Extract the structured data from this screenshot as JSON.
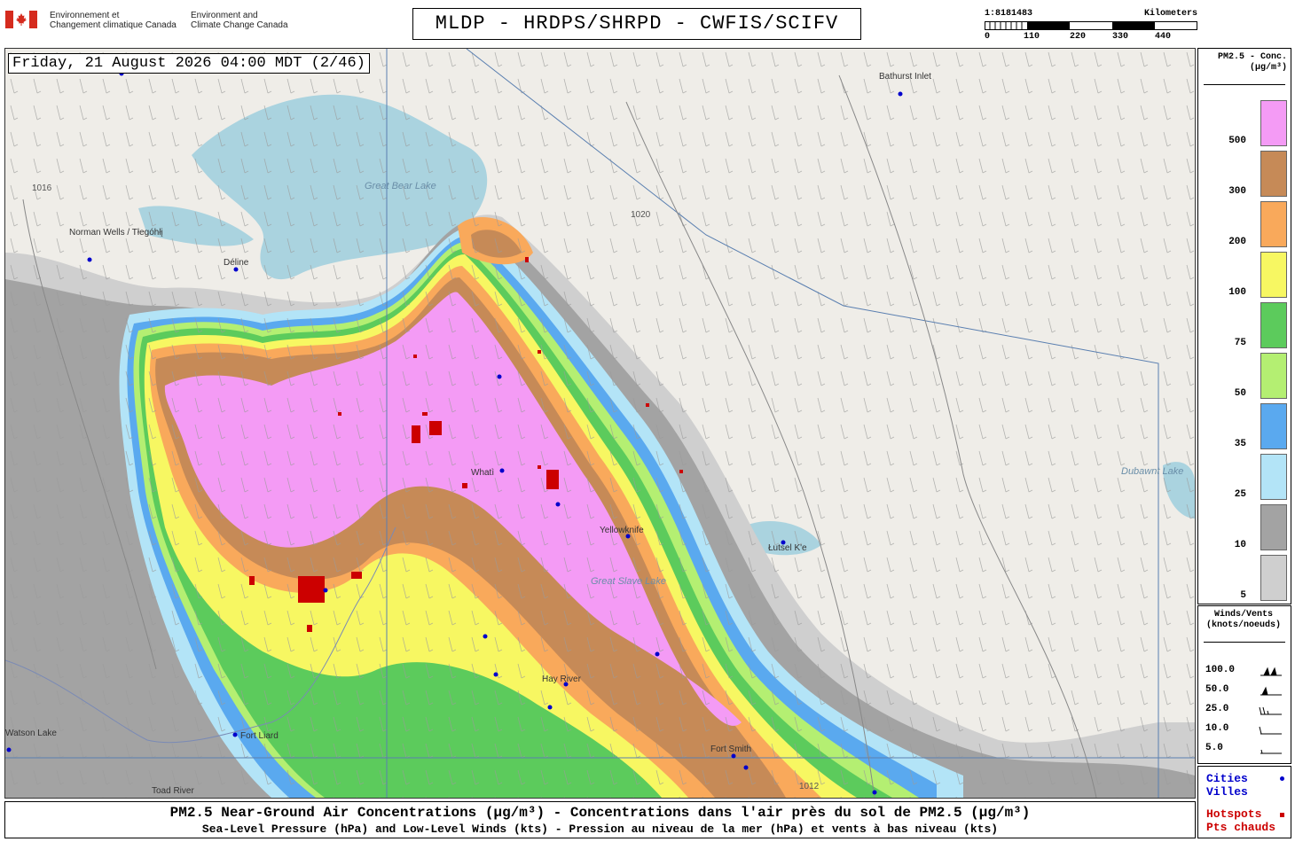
{
  "header": {
    "gov_fr": [
      "Environnement et",
      "Changement climatique Canada"
    ],
    "gov_en": [
      "Environment and",
      "Climate Change Canada"
    ],
    "title": "MLDP - HRDPS/SHRPD - CWFIS/SCIFV",
    "scale_ratio": "1:8181483",
    "scale_unit": "Kilometers",
    "scale_labels": [
      "0",
      "110",
      "220",
      "330",
      "440"
    ]
  },
  "map": {
    "timestamp": "Friday, 21 August 2026 04:00 MDT (2/46)",
    "cities": [
      "Norman Wells / Tłegóhłį",
      "Déline",
      "Whatì",
      "Yellowknife",
      "Łutsel K'e",
      "Hay River",
      "Fort Smith",
      "Fort Liard",
      "Bathurst Inlet",
      "Toad River",
      "Watson Lake"
    ],
    "lakes": [
      "Great Bear Lake",
      "Great Slave Lake",
      "Dubawnt Lake"
    ],
    "isobars": [
      "1016",
      "1020",
      "1012"
    ]
  },
  "legend": {
    "title": [
      "PM2.5 - Conc.",
      "(µg/m³)"
    ],
    "levels": [
      {
        "label": "500",
        "color": "#f49bf5"
      },
      {
        "label": "300",
        "color": "#c68a57"
      },
      {
        "label": "200",
        "color": "#f9a95b"
      },
      {
        "label": "100",
        "color": "#f7f762"
      },
      {
        "label": "75",
        "color": "#5ccb5c"
      },
      {
        "label": "50",
        "color": "#b4ef72"
      },
      {
        "label": "35",
        "color": "#5aa9ef"
      },
      {
        "label": "25",
        "color": "#b3e4f7"
      },
      {
        "label": "10",
        "color": "#a3a3a3"
      },
      {
        "label": "5",
        "color": "#cfcfcf"
      }
    ]
  },
  "winds": {
    "title": [
      "Winds/Vents",
      "(knots/noeuds)"
    ],
    "rows": [
      "100.0",
      "50.0",
      "25.0",
      "10.0",
      "5.0"
    ]
  },
  "keys": {
    "cities": [
      "Cities",
      "Villes"
    ],
    "hotspots": [
      "Hotspots",
      "Pts chauds"
    ]
  },
  "footer": {
    "line1": "PM2.5 Near-Ground Air Concentrations (µg/m³) - Concentrations dans l'air près du sol de PM2.5 (µg/m³)",
    "line2": "Sea-Level Pressure (hPa) and Low-Level Winds (kts) - Pression au niveau de la mer (hPa) et vents à bas niveau (kts)"
  }
}
